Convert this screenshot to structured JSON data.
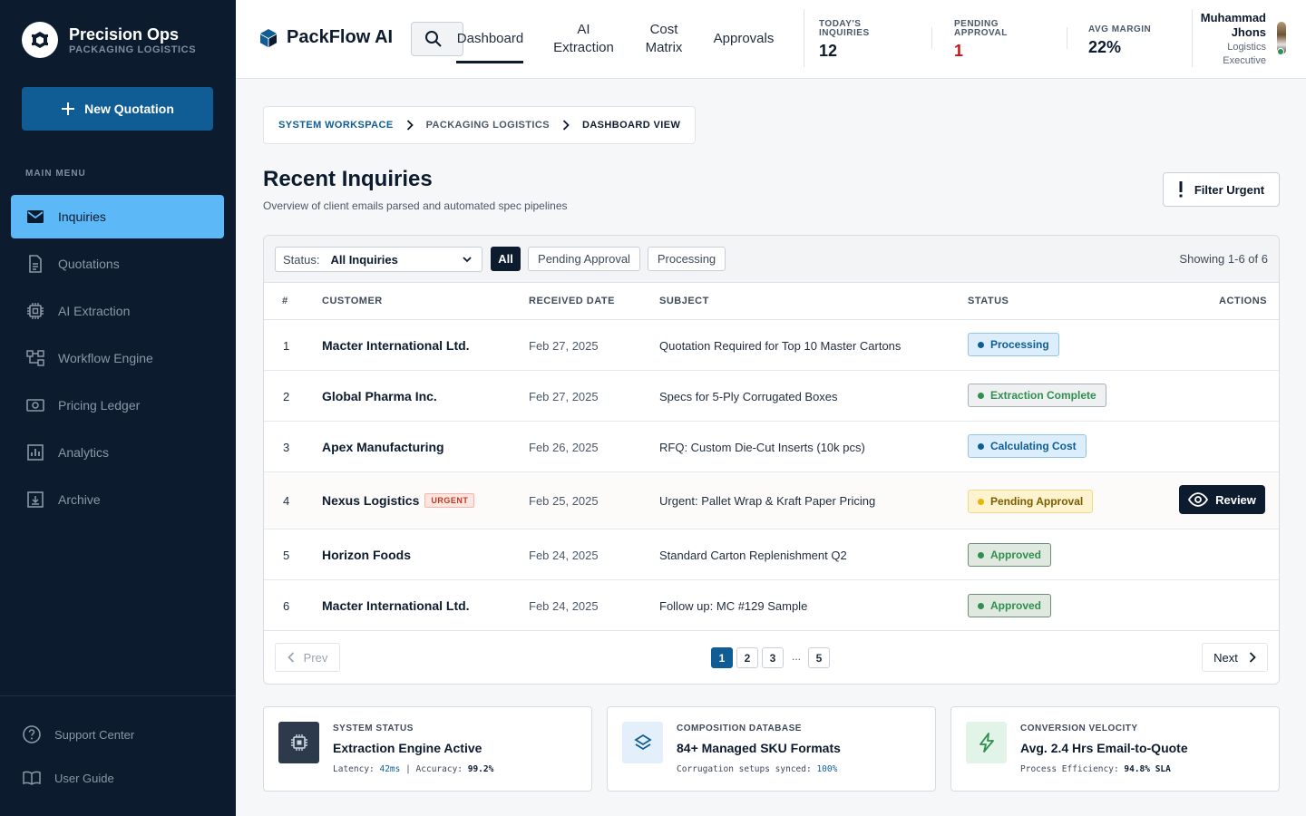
{
  "sidebar": {
    "brand_title": "Precision Ops",
    "brand_subtitle": "PACKAGING LOGISTICS",
    "new_button": "New Quotation",
    "menu_label": "MAIN MENU",
    "items": [
      {
        "label": "Inquiries",
        "icon": "mail-icon",
        "active": true
      },
      {
        "label": "Quotations",
        "icon": "document-icon"
      },
      {
        "label": "AI Extraction",
        "icon": "chip-icon"
      },
      {
        "label": "Workflow Engine",
        "icon": "workflow-icon"
      },
      {
        "label": "Pricing Ledger",
        "icon": "money-icon"
      },
      {
        "label": "Analytics",
        "icon": "chart-icon"
      },
      {
        "label": "Archive",
        "icon": "archive-icon"
      }
    ],
    "footer": [
      {
        "label": "Support Center",
        "icon": "help-icon"
      },
      {
        "label": "User Guide",
        "icon": "book-icon"
      }
    ]
  },
  "header": {
    "app_name": "PackFlow AI",
    "tabs": [
      {
        "label": "Dashboard",
        "active": true
      },
      {
        "label": "AI Extraction"
      },
      {
        "label": "Cost Matrix"
      },
      {
        "label": "Approvals"
      }
    ],
    "stats": [
      {
        "label": "TODAY'S INQUIRIES",
        "value": "12"
      },
      {
        "label": "PENDING APPROVAL",
        "value": "1"
      },
      {
        "label": "AVG MARGIN",
        "value": "22%"
      }
    ],
    "user_name": "Muhammad Jhons",
    "user_role": "Logistics Executive"
  },
  "breadcrumb": [
    "SYSTEM WORKSPACE",
    "PACKAGING LOGISTICS",
    "DASHBOARD VIEW"
  ],
  "page": {
    "title": "Recent Inquiries",
    "subtitle": "Overview of client emails parsed and automated spec pipelines",
    "filter_button": "Filter Urgent"
  },
  "table": {
    "status_label": "Status:",
    "status_value": "All Inquiries",
    "chips": [
      "All",
      "Pending Approval",
      "Processing"
    ],
    "showing": "Showing 1-6 of 6",
    "columns": [
      "#",
      "CUSTOMER",
      "RECEIVED DATE",
      "SUBJECT",
      "STATUS",
      "ACTIONS"
    ],
    "rows": [
      {
        "num": "1",
        "customer": "Macter International Ltd.",
        "date": "Feb 27, 2025",
        "subject": "Quotation Required for Top 10 Master Cartons",
        "status": "Processing"
      },
      {
        "num": "2",
        "customer": "Global Pharma Inc.",
        "date": "Feb 27, 2025",
        "subject": "Specs for 5-Ply Corrugated Boxes",
        "status": "Extraction Complete"
      },
      {
        "num": "3",
        "customer": "Apex Manufacturing",
        "date": "Feb 26, 2025",
        "subject": "RFQ: Custom Die-Cut Inserts (10k pcs)",
        "status": "Calculating Cost"
      },
      {
        "num": "4",
        "customer": "Nexus Logistics",
        "tag": "URGENT",
        "date": "Feb 25, 2025",
        "subject": "Urgent: Pallet Wrap & Kraft Paper Pricing",
        "status": "Pending Approval",
        "action": "Review"
      },
      {
        "num": "5",
        "customer": "Horizon Foods",
        "date": "Feb 24, 2025",
        "subject": "Standard Carton Replenishment Q2",
        "status": "Approved"
      },
      {
        "num": "6",
        "customer": "Macter International Ltd.",
        "date": "Feb 24, 2025",
        "subject": "Follow up: MC #129 Sample",
        "status": "Approved"
      }
    ],
    "pager": {
      "prev": "Prev",
      "next": "Next",
      "pages": [
        "1",
        "2",
        "3",
        "5"
      ],
      "ellipsis": "...",
      "current": "1"
    }
  },
  "info_cards": [
    {
      "label": "SYSTEM STATUS",
      "title": "Extraction Engine Active",
      "meta_a": "Latency: ",
      "meta_a_val": "42ms",
      "meta_b": " | Accuracy: ",
      "meta_b_val": "99.2%"
    },
    {
      "label": "COMPOSITION DATABASE",
      "title": "84+ Managed SKU Formats",
      "meta_a": "Corrugation setups synced: ",
      "meta_a_val": "100%"
    },
    {
      "label": "CONVERSION VELOCITY",
      "title": "Avg. 2.4 Hrs Email-to-Quote",
      "meta_a": "Process Efficiency: ",
      "meta_a_val": "94.8% SLA"
    }
  ],
  "colors": {
    "sidebar_bg": "#0c1b2e",
    "primary": "#0f5d94",
    "active_nav": "#5cb8f7",
    "danger": "#c01818"
  }
}
